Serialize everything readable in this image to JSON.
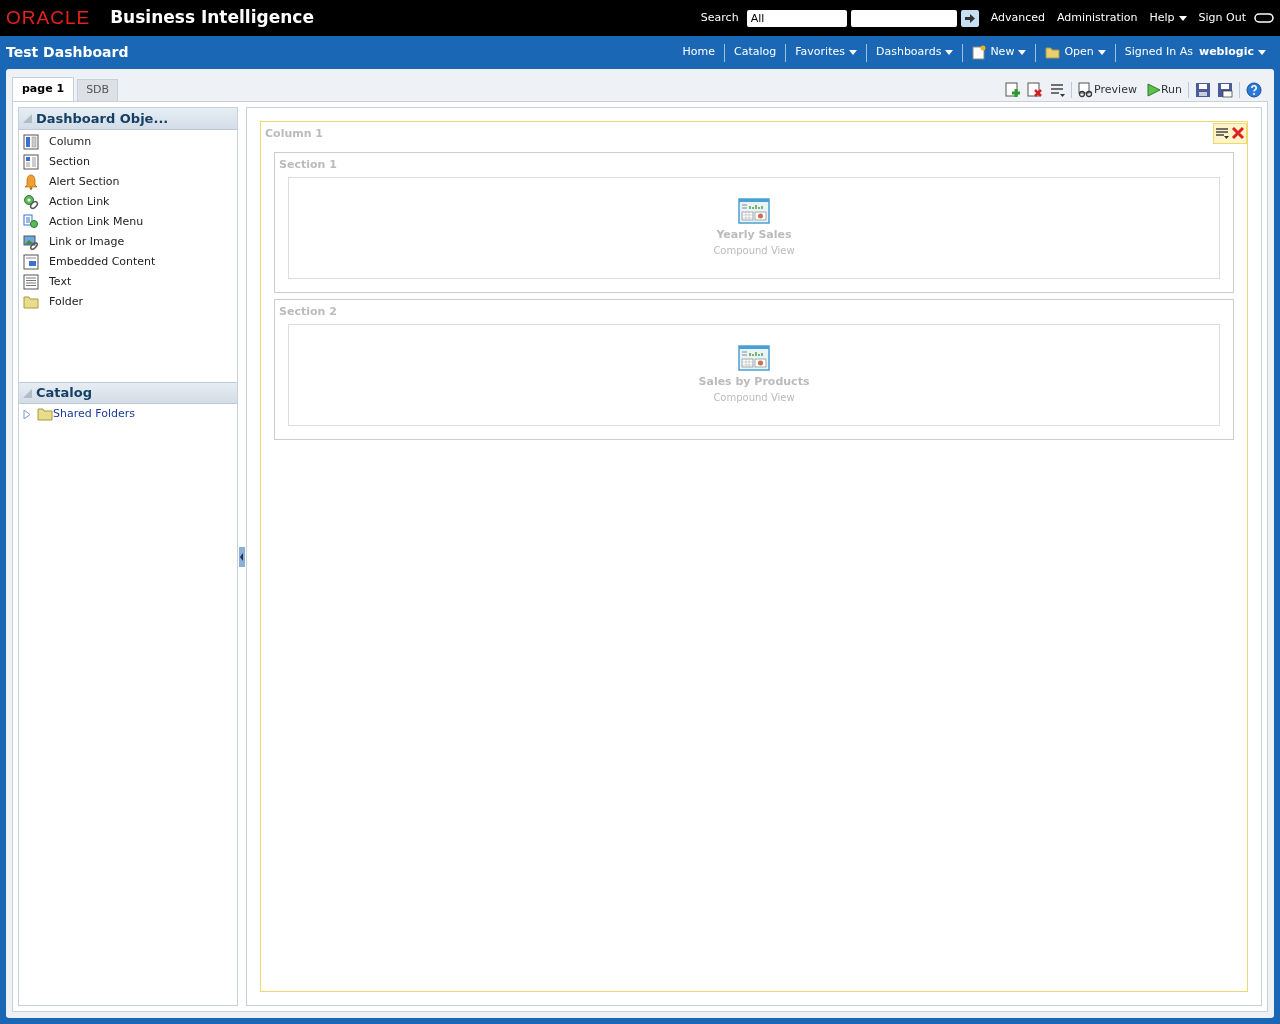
{
  "header": {
    "logo": "ORACLE",
    "product": "Business Intelligence",
    "search_label": "Search",
    "search_scope": "All",
    "links": [
      {
        "label": "Advanced",
        "dropdown": false
      },
      {
        "label": "Administration",
        "dropdown": false
      },
      {
        "label": "Help",
        "dropdown": true
      },
      {
        "label": "Sign Out",
        "dropdown": false
      }
    ]
  },
  "nav": {
    "title": "Test Dashboard",
    "items": [
      {
        "label": "Home",
        "kind": "plain",
        "dropdown": false
      },
      {
        "label": "Catalog",
        "kind": "plain",
        "dropdown": false
      },
      {
        "label": "Favorites",
        "kind": "plain",
        "dropdown": true
      },
      {
        "label": "Dashboards",
        "kind": "plain",
        "dropdown": true
      },
      {
        "label": "New",
        "kind": "new",
        "dropdown": true
      },
      {
        "label": "Open",
        "kind": "open",
        "dropdown": true
      }
    ],
    "signed_in_label": "Signed In As",
    "user": "weblogic"
  },
  "tabs": [
    {
      "label": "page 1",
      "selected": true
    },
    {
      "label": "SDB",
      "selected": false
    }
  ],
  "toolbar": {
    "preview": "Preview",
    "run": "Run"
  },
  "objects_panel": {
    "title": "Dashboard Obje...",
    "items": [
      {
        "label": "Column",
        "kind": "column"
      },
      {
        "label": "Section",
        "kind": "section"
      },
      {
        "label": "Alert Section",
        "kind": "alert"
      },
      {
        "label": "Action Link",
        "kind": "action"
      },
      {
        "label": "Action Link Menu",
        "kind": "actionmenu"
      },
      {
        "label": "Link or Image",
        "kind": "image"
      },
      {
        "label": "Embedded Content",
        "kind": "embedded"
      },
      {
        "label": "Text",
        "kind": "text"
      },
      {
        "label": "Folder",
        "kind": "folder"
      }
    ]
  },
  "catalog_panel": {
    "title": "Catalog",
    "items": [
      {
        "label": "Shared Folders",
        "expanded": false
      }
    ]
  },
  "column": {
    "title": "Column 1",
    "sections": [
      {
        "title": "Section 1",
        "view": {
          "name": "Yearly Sales",
          "type": "Compound View"
        }
      },
      {
        "title": "Section 2",
        "view": {
          "name": "Sales by Products",
          "type": "Compound View"
        }
      }
    ]
  }
}
